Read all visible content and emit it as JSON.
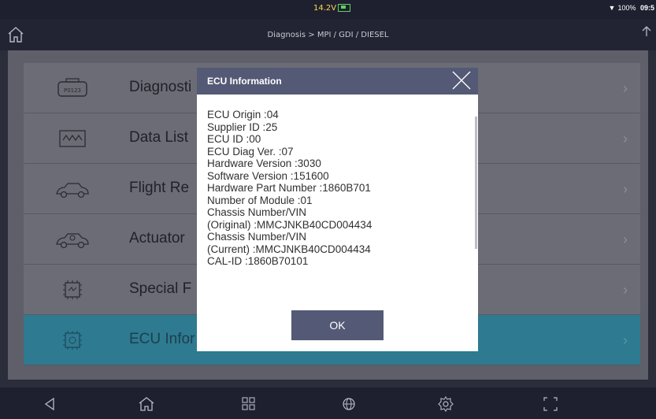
{
  "status_bar": {
    "voltage": "14.2V",
    "battery": "100%",
    "time": "09:5"
  },
  "title_bar": {
    "breadcrumb": "Diagnosis > MPI / GDI / DIESEL"
  },
  "menu": {
    "items": [
      {
        "label": "Diagnosti",
        "icon": "dtc-code-icon"
      },
      {
        "label": "Data List",
        "icon": "waveform-icon"
      },
      {
        "label": "Flight Re",
        "icon": "car-icon"
      },
      {
        "label": "Actuator",
        "icon": "car-actuator-icon"
      },
      {
        "label": "Special F",
        "icon": "chip-icon"
      },
      {
        "label": "ECU Infor",
        "icon": "chip-icon",
        "active": true
      }
    ]
  },
  "dialog": {
    "title": "ECU Information",
    "lines": [
      "ECU Origin :04",
      "Supplier ID :25",
      "ECU ID :00",
      "ECU Diag Ver. :07",
      "Hardware Version :3030",
      "Software Version :151600",
      "Hardware Part Number :1860B701",
      "Number of Module :01",
      "Chassis Number/VIN",
      "(Original) :MMCJNKB40CD004434",
      "Chassis Number/VIN",
      "(Current) :MMCJNKB40CD004434",
      "CAL-ID :1860B70101"
    ],
    "ok_label": "OK"
  },
  "nav_bar": {
    "buttons": [
      "back-icon",
      "home-icon",
      "apps-icon",
      "globe-icon",
      "settings-icon",
      "screenshot-icon"
    ]
  },
  "colors": {
    "dialog_header": "#545976",
    "active_item": "#2e7a91",
    "list_background": "#6b6c75"
  }
}
